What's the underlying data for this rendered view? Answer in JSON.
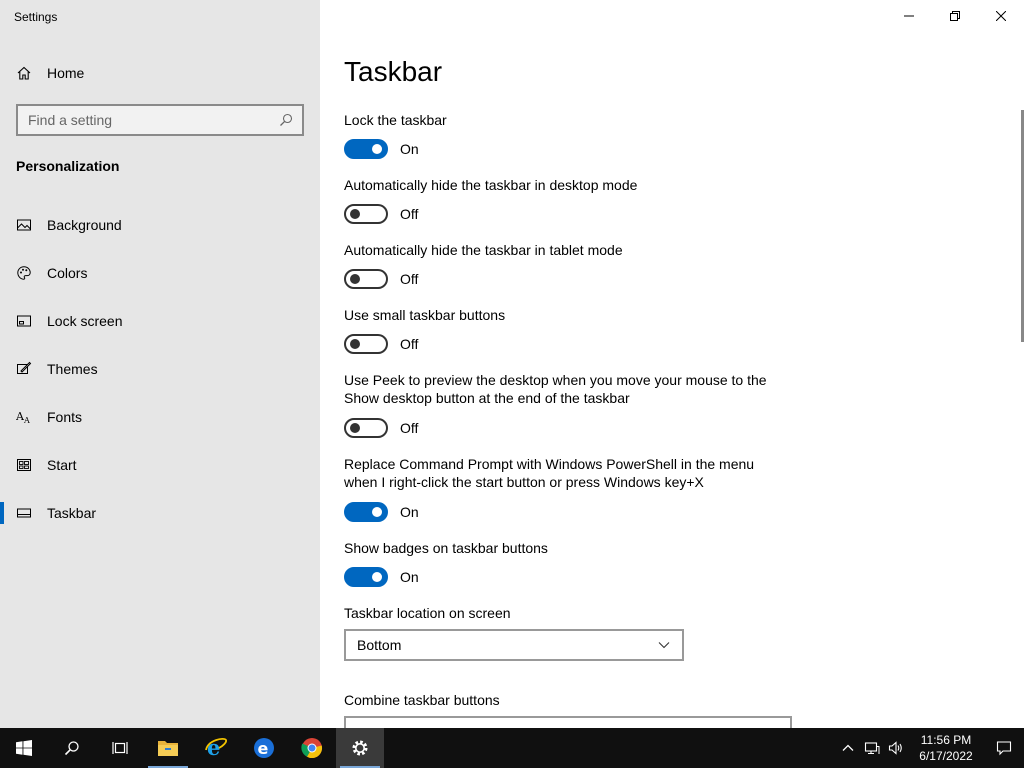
{
  "window": {
    "title": "Settings"
  },
  "sidebar": {
    "home_label": "Home",
    "search_placeholder": "Find a setting",
    "section_title": "Personalization",
    "items": [
      {
        "label": "Background",
        "icon": "picture-icon"
      },
      {
        "label": "Colors",
        "icon": "palette-icon"
      },
      {
        "label": "Lock screen",
        "icon": "lock-screen-icon"
      },
      {
        "label": "Themes",
        "icon": "themes-icon"
      },
      {
        "label": "Fonts",
        "icon": "fonts-icon"
      },
      {
        "label": "Start",
        "icon": "start-icon"
      },
      {
        "label": "Taskbar",
        "icon": "taskbar-icon",
        "selected": true
      }
    ]
  },
  "main": {
    "title": "Taskbar",
    "settings": [
      {
        "label": "Lock the taskbar",
        "state": "On"
      },
      {
        "label": "Automatically hide the taskbar in desktop mode",
        "state": "Off"
      },
      {
        "label": "Automatically hide the taskbar in tablet mode",
        "state": "Off"
      },
      {
        "label": "Use small taskbar buttons",
        "state": "Off"
      },
      {
        "label": "Use Peek to preview the desktop when you move your mouse to the Show desktop button at the end of the taskbar",
        "state": "Off"
      },
      {
        "label": "Replace Command Prompt with Windows PowerShell in the menu when I right-click the start button or press Windows key+X",
        "state": "On"
      },
      {
        "label": "Show badges on taskbar buttons",
        "state": "On"
      }
    ],
    "location": {
      "label": "Taskbar location on screen",
      "value": "Bottom"
    },
    "combine": {
      "label": "Combine taskbar buttons"
    }
  },
  "taskbar": {
    "apps": [
      "start-icon",
      "search-icon",
      "task-view-icon",
      "file-explorer-icon",
      "internet-explorer-icon",
      "edge-icon",
      "chrome-icon",
      "settings-gear-icon"
    ],
    "clock": {
      "time": "11:56 PM",
      "date": "6/17/2022"
    }
  },
  "colors": {
    "accent": "#0067c0",
    "sidebar": "#e6e6e6",
    "taskbar": "#101010"
  }
}
